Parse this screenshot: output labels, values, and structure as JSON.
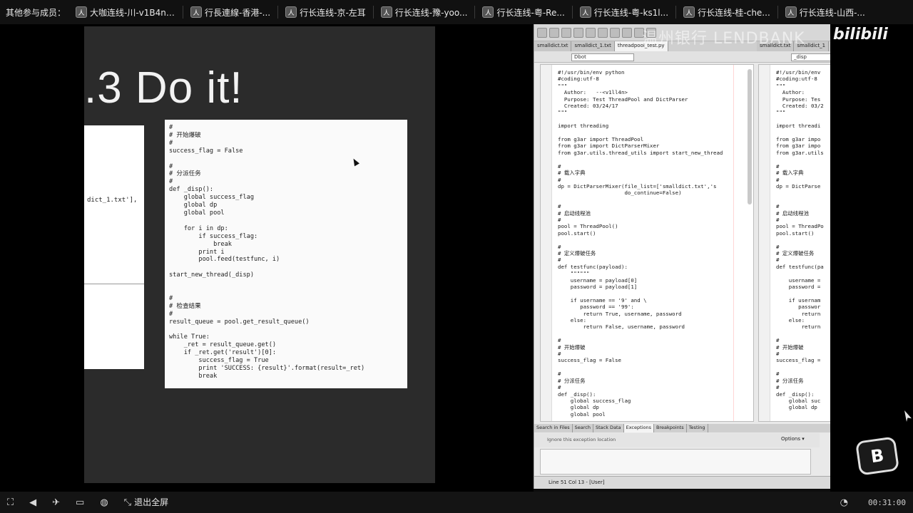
{
  "topbar": {
    "members_label": "其他参与成员：",
    "participants": [
      {
        "name": "大咖连线-川-v1B4n ◦))"
      },
      {
        "name": "行長連線-香港-..."
      },
      {
        "name": "行长连线-京-左耳"
      },
      {
        "name": "行长连线-豫-yoo..."
      },
      {
        "name": "行长连线-粤-Re..."
      },
      {
        "name": "行长连线-粤-ks1l..."
      },
      {
        "name": "行长连线-桂-che..."
      },
      {
        "name": "行长连线-山西-..."
      }
    ]
  },
  "slide": {
    "title": ".3 Do it!",
    "card_a_line": "dict_1.txt'],",
    "card_b_code": "#\n# 开始爆破\n#\nsuccess_flag = False\n\n#\n# 分派任务\n#\ndef _disp():\n    global success_flag\n    global dp\n    global pool\n\n    for i in dp:\n        if success_flag:\n            break\n        print i\n        pool.feed(testfunc, i)\n\nstart_new_thread(_disp)\n\n\n#\n# 检查结果\n#\nresult_queue = pool.get_result_queue()\n\nwhile True:\n    _ret = result_queue.get()\n    if _ret.get('result')[0]:\n        success_flag = True\n        print 'SUCCESS: {result}'.format(result=_ret)\n        break"
  },
  "ide": {
    "tabs": [
      "smalldict.txt",
      "smalldict_1.txt",
      "threadpool_test.py"
    ],
    "tabs_right": [
      "smalldict.txt",
      "smalldict_1"
    ],
    "search_value": "Dbot",
    "search_right_value": "_disp",
    "editor_code": "#!/usr/bin/env python\n#coding:utf-8\n\"\"\"\n  Author:   --<v1ll4n>\n  Purpose: Test ThreadPool and DictParser\n  Created: 03/24/17\n\"\"\"\n\nimport threading\n\nfrom g3ar import ThreadPool\nfrom g3ar import DictParserMixer\nfrom g3ar.utils.thread_utils import start_new_thread\n\n#\n# 载入字典\n#\ndp = DictParserMixer(file_list=['smalldict.txt','s\n                     do_continue=False)\n\n#\n# 启动线程池\n#\npool = ThreadPool()\npool.start()\n\n#\n# 定义爆破任务\n#\ndef testfunc(payload):\n    \"\"\"\"\"\"\n    username = payload[0]\n    password = payload[1]\n\n    if username == '9' and \\\n       password == '99':\n        return True, username, password\n    else:\n        return False, username, password\n\n#\n# 开始爆破\n#\nsuccess_flag = False\n\n#\n# 分派任务\n#\ndef _disp():\n    global success_flag\n    global dp\n    global pool",
    "editor_right_code": "#!/usr/bin/env\n#coding:utf-8\n\"\"\"\n  Author:\n  Purpose: Tes\n  Created: 03/2\n\"\"\"\n\nimport threadi\n\nfrom g3ar impo\nfrom g3ar impo\nfrom g3ar.utils\n\n#\n# 载入字典\n#\ndp = DictParse\n\n\n#\n# 启动线程池\n#\npool = ThreadPo\npool.start()\n\n#\n# 定义爆破任务\n#\ndef testfunc(pa\n\n    username =\n    password =\n\n    if usernam\n       passwor\n        return\n    else:\n        return\n\n#\n# 开始爆破\n#\nsuccess_flag =\n\n#\n# 分派任务\n#\ndef _disp():\n    global suc\n    global dp",
    "bottom_tabs": [
      "Search in Files",
      "Search",
      "Stack Data",
      "Exceptions",
      "Breakpoints",
      "Testing"
    ],
    "ignore_text": "Ignore this exception location",
    "options_label": "Options ▾",
    "status": "Line 51 Col 13 - [User]"
  },
  "watermark": "温州银行 LENDBANK",
  "brand": "bilibili",
  "b_logo": "B",
  "controls": {
    "exit_fullscreen": "退出全屏",
    "time": "00:31:00"
  }
}
